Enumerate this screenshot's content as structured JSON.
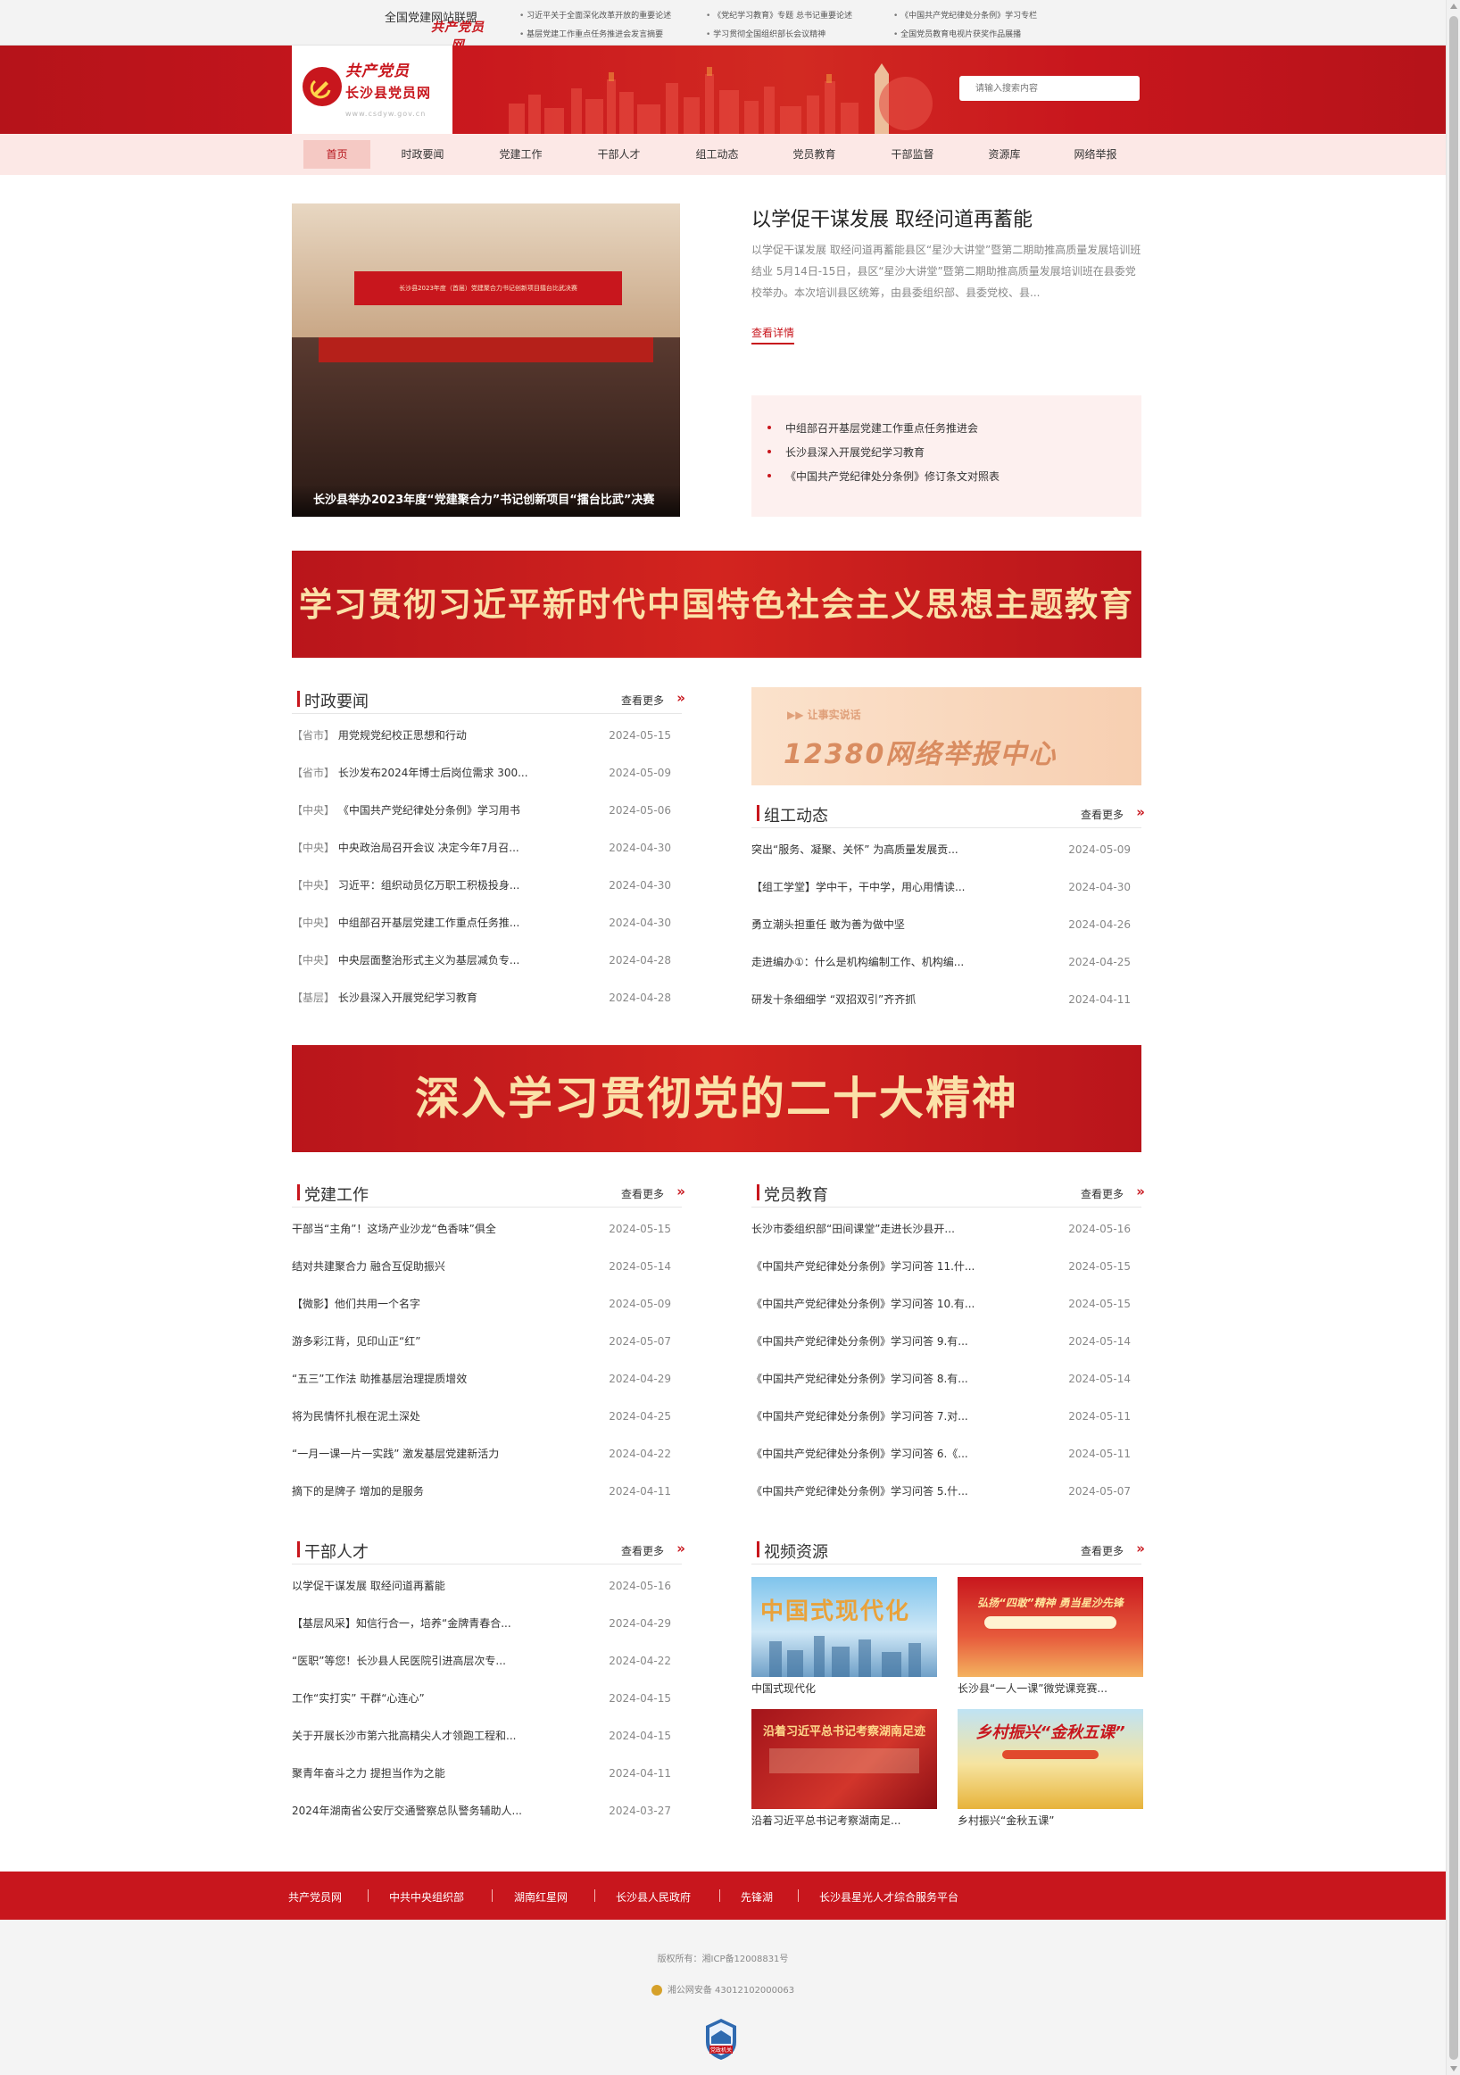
{
  "alliance": {
    "logo_script": "共产党员网",
    "title": "全国党建网站联盟"
  },
  "top_news": [
    [
      "习近平关于全面深化改革开放的重要论述",
      "基层党建工作重点任务推进会发言摘要"
    ],
    [
      "《党纪学习教育》专题  总书记重要论述",
      "学习贯彻全国组织部长会议精神"
    ],
    [
      "《中国共产党纪律处分条例》学习专栏",
      "全国党员教育电视片获奖作品展播"
    ]
  ],
  "header": {
    "logo_script": "共产党员",
    "site_name": "长沙县党员网",
    "site_url": "www.csdyw.gov.cn",
    "search_placeholder": "请输入搜索内容"
  },
  "nav": [
    {
      "label": "首页",
      "active": true
    },
    {
      "label": "时政要闻"
    },
    {
      "label": "党建工作"
    },
    {
      "label": "干部人才"
    },
    {
      "label": "组工动态"
    },
    {
      "label": "党员教育"
    },
    {
      "label": "干部监督"
    },
    {
      "label": "资源库"
    },
    {
      "label": "网络举报"
    }
  ],
  "featured": {
    "image_caption": "长沙县举办2023年度“党建聚合力”书记创新项目“擂台比武”决赛",
    "screen_text": "长沙县2023年度（首届）党建聚合力书记创新项目擂台比武决赛",
    "title": "以学促干谋发展 取经问道再蓄能",
    "summary": " 以学促干谋发展  取经问道再蓄能县区“星沙大讲堂”暨第二期助推高质量发展培训班结业 5月14日-15日，县区“星沙大讲堂”暨第二期助推高质量发展培训班在县委党校举办。本次培训县区统筹，由县委组织部、县委党校、县...",
    "more_label": "查看详情",
    "list": [
      "中组部召开基层党建工作重点任务推进会",
      "长沙县深入开展党纪学习教育",
      "《中国共产党纪律处分条例》修订条文对照表"
    ]
  },
  "banners": {
    "theme_education": "学习贯彻习近平新时代中国特色社会主义思想主题教育",
    "twentieth_congress": "深入学习贯彻党的二十大精神"
  },
  "more_label": "查看更多",
  "news": {
    "title": "时政要闻",
    "items": [
      {
        "tag": "【省市】",
        "text": "用党规党纪校正思想和行动",
        "date": "2024-05-15"
      },
      {
        "tag": "【省市】",
        "text": "长沙发布2024年博士后岗位需求 300...",
        "date": "2024-05-09"
      },
      {
        "tag": "【中央】",
        "text": "《中国共产党纪律处分条例》学习用书",
        "date": "2024-05-06"
      },
      {
        "tag": "【中央】",
        "text": "中央政治局召开会议 决定今年7月召...",
        "date": "2024-04-30"
      },
      {
        "tag": "【中央】",
        "text": "习近平：组织动员亿万职工积极投身...",
        "date": "2024-04-30"
      },
      {
        "tag": "【中央】",
        "text": "中组部召开基层党建工作重点任务推...",
        "date": "2024-04-30"
      },
      {
        "tag": "【中央】",
        "text": "中央层面整治形式主义为基层减负专...",
        "date": "2024-04-28"
      },
      {
        "tag": "【基层】",
        "text": "长沙县深入开展党纪学习教育",
        "date": "2024-04-28"
      }
    ]
  },
  "report_center": {
    "slogan": "让事实说话",
    "title": "12380网络举报中心"
  },
  "org_news": {
    "title": "组工动态",
    "items": [
      {
        "text": "突出“服务、凝聚、关怀” 为高质量发展贡...",
        "date": "2024-05-09"
      },
      {
        "text": "【组工学堂】学中干，干中学，用心用情读...",
        "date": "2024-04-30"
      },
      {
        "text": "勇立潮头担重任 敢为善为做中坚",
        "date": "2024-04-26"
      },
      {
        "text": "走进编办①：什么是机构编制工作、机构编...",
        "date": "2024-04-25"
      },
      {
        "text": "研发十条细细学 “双招双引”齐齐抓",
        "date": "2024-04-11"
      }
    ]
  },
  "party_building": {
    "title": "党建工作",
    "items": [
      {
        "text": "干部当“主角”！这场产业沙龙“色香味”俱全",
        "date": "2024-05-15"
      },
      {
        "text": "结对共建聚合力 融合互促助振兴",
        "date": "2024-05-14"
      },
      {
        "text": "【微影】他们共用一个名字",
        "date": "2024-05-09"
      },
      {
        "text": "游多彩江背，见印山正“红”",
        "date": "2024-05-07"
      },
      {
        "text": "“五三”工作法 助推基层治理提质增效",
        "date": "2024-04-29"
      },
      {
        "text": "将为民情怀扎根在泥土深处",
        "date": "2024-04-25"
      },
      {
        "text": "“一月一课一片一实践” 激发基层党建新活力",
        "date": "2024-04-22"
      },
      {
        "text": "摘下的是牌子 增加的是服务",
        "date": "2024-04-11"
      }
    ]
  },
  "member_education": {
    "title": "党员教育",
    "items": [
      {
        "text": "长沙市委组织部“田间课堂”走进长沙县开...",
        "date": "2024-05-16"
      },
      {
        "text": "《中国共产党纪律处分条例》学习问答 11.什...",
        "date": "2024-05-15"
      },
      {
        "text": "《中国共产党纪律处分条例》学习问答 10.有...",
        "date": "2024-05-15"
      },
      {
        "text": "《中国共产党纪律处分条例》学习问答 9.有...",
        "date": "2024-05-14"
      },
      {
        "text": "《中国共产党纪律处分条例》学习问答 8.有...",
        "date": "2024-05-14"
      },
      {
        "text": "《中国共产党纪律处分条例》学习问答 7.对...",
        "date": "2024-05-11"
      },
      {
        "text": "《中国共产党纪律处分条例》学习问答 6.《...",
        "date": "2024-05-11"
      },
      {
        "text": "《中国共产党纪律处分条例》学习问答 5.什...",
        "date": "2024-05-07"
      }
    ]
  },
  "cadres": {
    "title": "干部人才",
    "items": [
      {
        "text": "以学促干谋发展 取经问道再蓄能",
        "date": "2024-05-16"
      },
      {
        "text": "【基层风采】知信行合一，培养“金牌青春合...",
        "date": "2024-04-29"
      },
      {
        "text": "“医职”等您！长沙县人民医院引进高层次专...",
        "date": "2024-04-22"
      },
      {
        "text": "工作“实打实” 干群“心连心”",
        "date": "2024-04-15"
      },
      {
        "text": "关于开展长沙市第六批高精尖人才领跑工程和...",
        "date": "2024-04-15"
      },
      {
        "text": "聚青年奋斗之力 提担当作为之能",
        "date": "2024-04-11"
      },
      {
        "text": "2024年湖南省公安厅交通警察总队警务辅助人...",
        "date": "2024-03-27"
      }
    ]
  },
  "videos": {
    "title": "视频资源",
    "items": [
      {
        "title": "中国式现代化",
        "thumb_text": "中国式现代化"
      },
      {
        "title": "长沙县“一人一课”微党课竞赛...",
        "thumb_text": "弘扬“四敢”精神 勇当星沙先锋"
      },
      {
        "title": "沿着习近平总书记考察湖南足...",
        "thumb_text": "沿着习近平总书记考察湖南足迹"
      },
      {
        "title": "乡村振兴“金秋五课”",
        "thumb_text": "乡村振兴“金秋五课”"
      }
    ]
  },
  "footer": {
    "links": [
      "共产党员网",
      "中共中央组织部",
      "湖南红星网",
      "长沙县人民政府",
      "先锋湖",
      "长沙县星光人才综合服务平台"
    ],
    "copyright": "版权所有：湘ICP备12008831号",
    "police": "湘公网安备 43012102000063",
    "gov_badge": "党政机关"
  },
  "colors": {
    "brand_red": "#c8161d",
    "nav_bg": "#fce8e6",
    "gold": "#fbe1a8"
  }
}
